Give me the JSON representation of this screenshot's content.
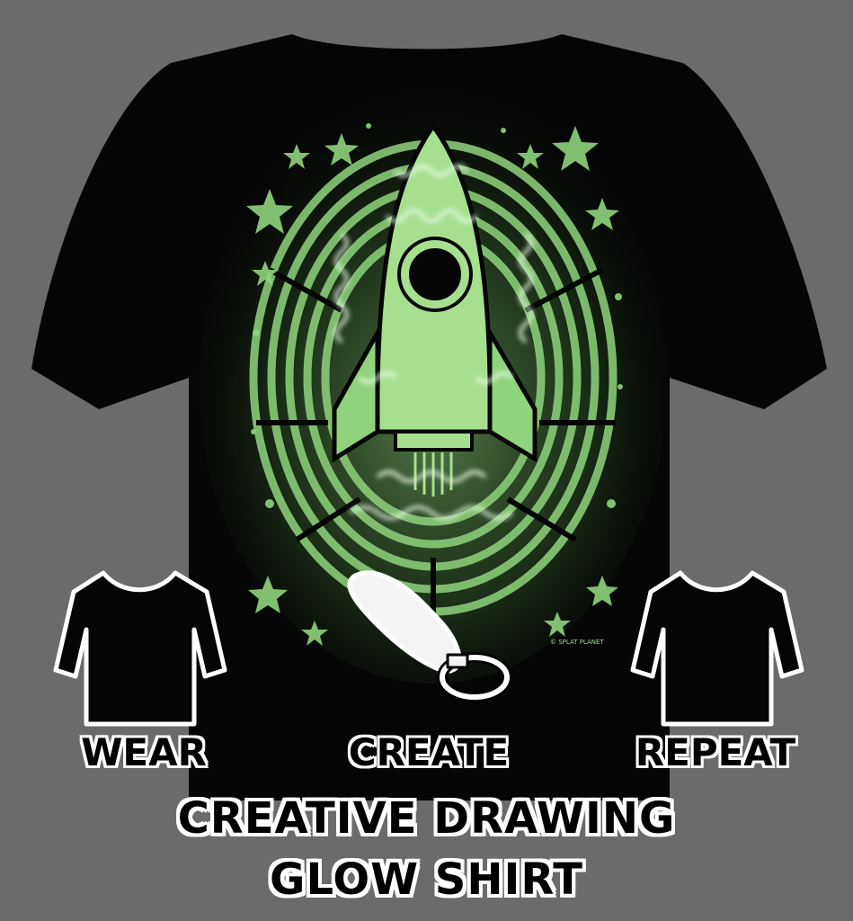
{
  "image": {
    "background_color": "#6b6b6b",
    "shirt_color": "#050505",
    "glow_color": "#8fd47c"
  },
  "steps": {
    "wear": "WEAR",
    "create": "CREATE",
    "repeat": "REPEAT"
  },
  "headline": {
    "line1": "CREATIVE DRAWING",
    "line2": "GLOW SHIRT"
  },
  "print": {
    "copyright": "© SPLAT PLANET"
  }
}
